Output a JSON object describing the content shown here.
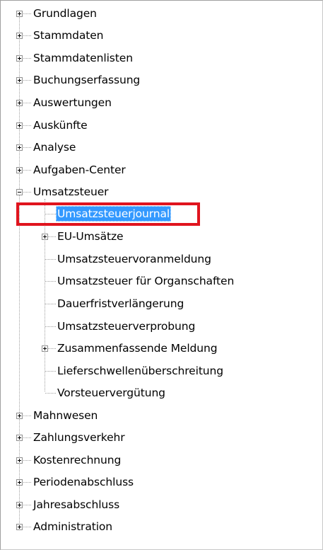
{
  "tree": {
    "items": [
      {
        "label": "Grundlagen",
        "expanded": false
      },
      {
        "label": "Stammdaten",
        "expanded": false
      },
      {
        "label": "Stammdatenlisten",
        "expanded": false
      },
      {
        "label": "Buchungserfassung",
        "expanded": false
      },
      {
        "label": "Auswertungen",
        "expanded": false
      },
      {
        "label": "Auskünfte",
        "expanded": false
      },
      {
        "label": "Analyse",
        "expanded": false
      },
      {
        "label": "Aufgaben-Center",
        "expanded": false
      },
      {
        "label": "Umsatzsteuer",
        "expanded": true,
        "children": [
          {
            "label": "Umsatzsteuerjournal",
            "selected": true
          },
          {
            "label": "EU-Umsätze",
            "expanded": false
          },
          {
            "label": "Umsatzsteuervoranmeldung"
          },
          {
            "label": "Umsatzsteuer für Organschaften"
          },
          {
            "label": "Dauerfristverlängerung"
          },
          {
            "label": "Umsatzsteuerverprobung"
          },
          {
            "label": "Zusammenfassende Meldung",
            "expanded": false
          },
          {
            "label": "Lieferschwellenüberschreitung"
          },
          {
            "label": "Vorsteuervergütung"
          }
        ]
      },
      {
        "label": "Mahnwesen",
        "expanded": false
      },
      {
        "label": "Zahlungsverkehr",
        "expanded": false
      },
      {
        "label": "Kostenrechnung",
        "expanded": false
      },
      {
        "label": "Periodenabschluss",
        "expanded": false
      },
      {
        "label": "Jahresabschluss",
        "expanded": false
      },
      {
        "label": "Administration",
        "expanded": false
      }
    ]
  },
  "colors": {
    "selection_bg": "#3399ff",
    "selection_text": "#ffffff",
    "highlight_border": "#e0141e",
    "tree_lines": "#a0a0a0"
  },
  "icons": {
    "collapsed": "plus-expander-icon",
    "expanded": "minus-expander-icon"
  }
}
